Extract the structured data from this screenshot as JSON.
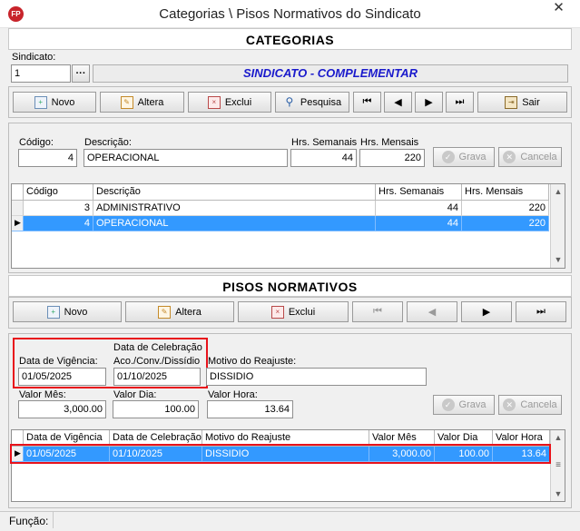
{
  "window": {
    "title": "Categorias \\ Pisos Normativos do Sindicato",
    "app_icon_text": "FP",
    "close": "✕"
  },
  "categorias": {
    "heading": "CATEGORIAS",
    "sindicato_label": "Sindicato:",
    "sindicato_value": "1",
    "lookup_button": "···",
    "sindicato_name": "SINDICATO - COMPLEMENTAR",
    "toolbar": {
      "novo": "Novo",
      "altera": "Altera",
      "exclui": "Exclui",
      "pesquisa": "Pesquisa",
      "first": "⏮",
      "prev": "◀",
      "next": "▶",
      "last": "⏭",
      "sair": "Sair"
    },
    "form": {
      "codigo_label": "Código:",
      "codigo_value": "4",
      "descricao_label": "Descrição:",
      "descricao_value": "OPERACIONAL",
      "hrs_sem_label": "Hrs. Semanais",
      "hrs_sem_value": "44",
      "hrs_men_label": "Hrs. Mensais",
      "hrs_men_value": "220",
      "grava": "Grava",
      "cancela": "Cancela"
    },
    "grid": {
      "columns": [
        "Código",
        "Descrição",
        "Hrs. Semanais",
        "Hrs. Mensais"
      ],
      "rows": [
        {
          "codigo": "3",
          "descricao": "ADMINISTRATIVO",
          "hrs_sem": "44",
          "hrs_men": "220"
        },
        {
          "codigo": "4",
          "descricao": "OPERACIONAL",
          "hrs_sem": "44",
          "hrs_men": "220"
        }
      ],
      "row_indicator": "▶"
    }
  },
  "pisos": {
    "heading": "PISOS NORMATIVOS",
    "toolbar": {
      "novo": "Novo",
      "altera": "Altera",
      "exclui": "Exclui",
      "first": "⏮",
      "prev": "◀",
      "next": "▶",
      "last": "⏭"
    },
    "form": {
      "data_vigencia_label": "Data de Vigência:",
      "data_vigencia_value": "01/05/2025",
      "data_celebracao_label_1": "Data de Celebração",
      "data_celebracao_label_2": "Aco./Conv./Dissídio",
      "data_celebracao_value": "01/10/2025",
      "motivo_label": "Motivo do Reajuste:",
      "motivo_value": "DISSIDIO",
      "valor_mes_label": "Valor Mês:",
      "valor_mes_value": "3,000.00",
      "valor_dia_label": "Valor Dia:",
      "valor_dia_value": "100.00",
      "valor_hora_label": "Valor Hora:",
      "valor_hora_value": "13.64",
      "grava": "Grava",
      "cancela": "Cancela"
    },
    "grid": {
      "columns": [
        "Data de Vigência",
        "Data de Celebração",
        "Motivo do Reajuste",
        "Valor Mês",
        "Valor Dia",
        "Valor Hora"
      ],
      "row": {
        "vigencia": "01/05/2025",
        "celebracao": "01/10/2025",
        "motivo": "DISSIDIO",
        "valor_mes": "3,000.00",
        "valor_dia": "100.00",
        "valor_hora": "13.64"
      },
      "row_indicator": "▶"
    }
  },
  "status": {
    "funcao_label": "Função:",
    "funcao_value": ""
  },
  "colors": {
    "selection": "#3399ff",
    "highlight_box": "#e8121b",
    "sindicato_text": "#1a1acc"
  }
}
